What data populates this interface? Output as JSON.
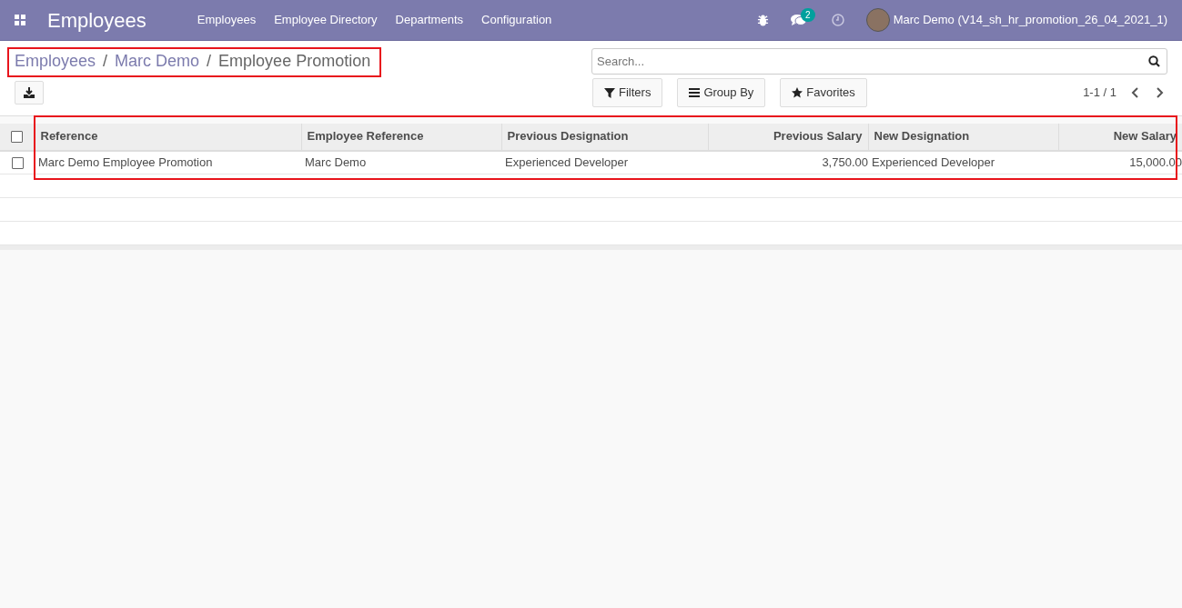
{
  "navbar": {
    "app_title": "Employees",
    "menu": [
      "Employees",
      "Employee Directory",
      "Departments",
      "Configuration"
    ],
    "messages_badge": "2",
    "user": "Marc Demo (V14_sh_hr_promotion_26_04_2021_1)"
  },
  "breadcrumbs": [
    "Employees",
    "Marc Demo",
    "Employee Promotion"
  ],
  "breadcrumb_separators": [
    "/",
    "/"
  ],
  "search": {
    "placeholder": "Search..."
  },
  "search_buttons": [
    "Filters",
    "Group By",
    "Favorites"
  ],
  "pager": "1-1 / 1",
  "table": {
    "select_all_checked": false,
    "columns": [
      {
        "label": "Reference",
        "kind": "text"
      },
      {
        "label": "Employee Reference",
        "kind": "text"
      },
      {
        "label": "Previous Designation",
        "kind": "text"
      },
      {
        "label": "Previous Salary",
        "kind": "number"
      },
      {
        "label": "New Designation",
        "kind": "text"
      },
      {
        "label": "New Salary",
        "kind": "number"
      }
    ],
    "rows": [
      {
        "checked": false,
        "cells": [
          "Marc Demo Employee Promotion",
          "Marc Demo",
          "Experienced Developer",
          "3,750.00",
          "Experienced Developer",
          "15,000.00"
        ]
      }
    ]
  }
}
